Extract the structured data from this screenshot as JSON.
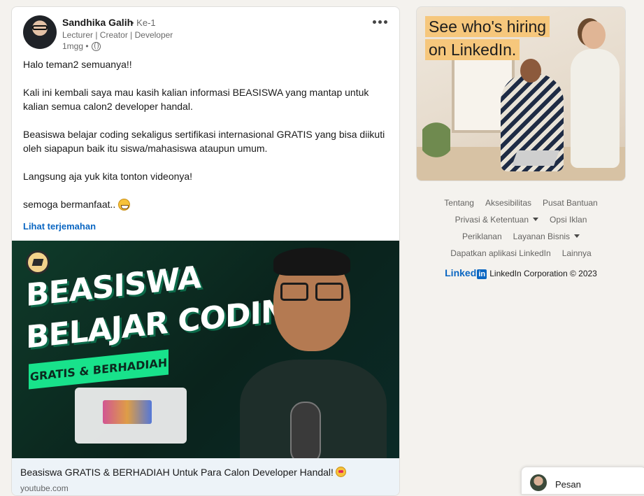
{
  "post": {
    "author": {
      "name": "Sandhika Galih",
      "degree": "• Ke-1",
      "headline": "Lecturer | Creator | Developer",
      "time": "1mgg •"
    },
    "body": {
      "p1": "Halo teman2 semuanya!!",
      "p2": "Kali ini kembali saya mau kasih kalian informasi BEASISWA yang mantap untuk kalian semua calon2 developer handal.",
      "p3": "Beasiswa belajar coding sekaligus sertifikasi internasional GRATIS yang bisa diikuti oleh siapapun baik itu siswa/mahasiswa ataupun umum.",
      "p4": "Langsung aja yuk kita tonton videonya!",
      "p5": "semoga bermanfaat.."
    },
    "translate_label": "Lihat terjemahan",
    "thumbnail": {
      "title_line1": "BEASISWA",
      "title_line2": "BELAJAR CODING",
      "ribbon": "GRATIS & BERHADIAH"
    },
    "link_preview": {
      "title": "Beasiswa GRATIS & BERHADIAH Untuk Para Calon Developer Handal!",
      "domain": "youtube.com"
    }
  },
  "ad": {
    "headline_line1": "See who's hiring",
    "headline_line2": "on LinkedIn."
  },
  "footer": {
    "links_row1": [
      "Tentang",
      "Aksesibilitas",
      "Pusat Bantuan"
    ],
    "privacy": "Privasi & Ketentuan",
    "ad_options": "Opsi Iklan",
    "advertising": "Periklanan",
    "business": "Layanan Bisnis",
    "get_app": "Dapatkan aplikasi LinkedIn",
    "more": "Lainnya",
    "brand_word": "Linked",
    "brand_in": "in",
    "copyright": "LinkedIn Corporation © 2023"
  },
  "messaging": {
    "label": "Pesan"
  },
  "colors": {
    "accent": "#0a66c2",
    "page_bg": "#f4f2ee",
    "ad_highlight": "#f6c77c",
    "thumbnail_green": "#18e28b"
  }
}
